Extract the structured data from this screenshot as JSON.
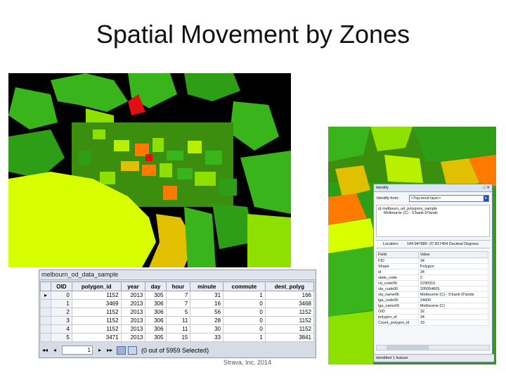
{
  "slide": {
    "title": "Spatial Movement by Zones",
    "credit": "Strava, Inc. 2014"
  },
  "colors": {
    "map_background": "#000000",
    "bay_yellow": "#d8ff00",
    "zone_green": "#39b51b",
    "zone_lime": "#8ee000",
    "zone_orange": "#ff7a00",
    "zone_red": "#e01010"
  },
  "table": {
    "window_title": "melbourn_od_data_sample",
    "columns": [
      "OID",
      "polygon_id",
      "year",
      "day",
      "hour",
      "minute",
      "commute",
      "dest_polyg"
    ],
    "rows": [
      [
        "0",
        "1152",
        "2013",
        "305",
        "7",
        "31",
        "1",
        "166"
      ],
      [
        "1",
        "3469",
        "2013",
        "306",
        "7",
        "16",
        "0",
        "3468"
      ],
      [
        "2",
        "1152",
        "2013",
        "306",
        "5",
        "56",
        "0",
        "1152"
      ],
      [
        "3",
        "1152",
        "2013",
        "306",
        "11",
        "28",
        "0",
        "1152"
      ],
      [
        "4",
        "1152",
        "2013",
        "306",
        "11",
        "30",
        "0",
        "1152"
      ],
      [
        "5",
        "3471",
        "2013",
        "305",
        "15",
        "33",
        "1",
        "3841"
      ]
    ],
    "nav": {
      "first": "◂◂",
      "prev": "◂",
      "page": "1",
      "next": "▸",
      "last": "▸▸",
      "selection_text": "(0 out of 5959 Selected)"
    }
  },
  "identify": {
    "title": "Identify",
    "controls": "□ ✕",
    "from_label": "Identify from:",
    "from_value": "<Top-most layer>",
    "tree_parent": "⊟ melbourn_od_polygons_sample",
    "tree_child": "Melbourne (C) - S'bank-D'lands",
    "location_label": "Location:",
    "location_value": "144.947886  -37.817404 Decimal Degrees",
    "grid_headers": [
      "Field",
      "Value"
    ],
    "fields": [
      [
        "FID",
        "34"
      ],
      [
        "Shape",
        "Polygon"
      ],
      [
        "id",
        "34"
      ],
      [
        "state_code",
        "2"
      ],
      [
        "cd_code06",
        "2290916"
      ],
      [
        "sla_code06",
        "205054605"
      ],
      [
        "sla_name06",
        "Melbourne (C) - S'bank-D'lands"
      ],
      [
        "lga_code06",
        "24600"
      ],
      [
        "lga_name06",
        "Melbourne (C)"
      ],
      [
        "OID",
        "32"
      ],
      [
        "polygon_id",
        "34"
      ],
      [
        "Count_polygon_id",
        "33"
      ]
    ],
    "status": "Identified 1 feature"
  }
}
